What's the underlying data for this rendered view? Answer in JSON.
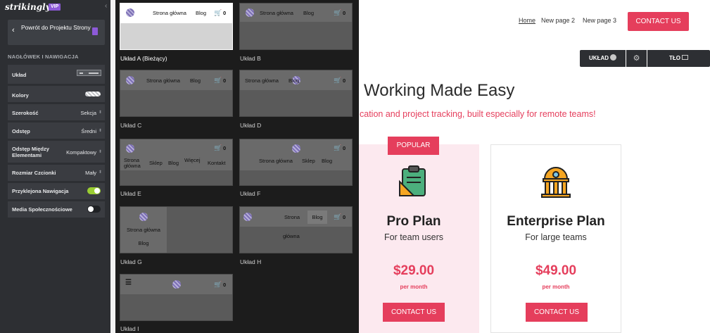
{
  "sidebar": {
    "logo": "strikingly",
    "vip": "VIP",
    "collapse": "‹",
    "back": "Powrót do Projektu Strony",
    "section_title": "NAGŁÓWEK I NAWIGACJA",
    "rows": [
      {
        "label": "Układ",
        "value": ""
      },
      {
        "label": "Kolory",
        "value": ""
      },
      {
        "label": "Szerokość",
        "value": "Sekcja"
      },
      {
        "label": "Odstęp",
        "value": "Średni"
      },
      {
        "label": "Odstęp Między Elementami",
        "value": "Kompaktowy"
      },
      {
        "label": "Rozmiar Czcionki",
        "value": "Mały"
      },
      {
        "label": "Przyklejona Nawigacja",
        "toggle": true
      },
      {
        "label": "Media Społecznościowe",
        "toggle": false
      }
    ]
  },
  "layouts": {
    "nav_home": "Strona główna",
    "nav_blog": "Blog",
    "nav_shop": "Sklep",
    "nav_more": "Więcej",
    "nav_contact": "Kontakt",
    "nav_strona": "Strona",
    "nav_glowna": "główna",
    "cart": "0",
    "captions": {
      "a": "Układ A (Bieżący)",
      "b": "Układ B",
      "c": "Układ C",
      "d": "Układ D",
      "e": "Układ E",
      "f": "Układ F",
      "g": "Układ G",
      "h": "Układ H",
      "i": "Układ I"
    }
  },
  "site": {
    "nav": [
      "Home",
      "New page 2",
      "New page 3"
    ],
    "contact": "CONTACT US",
    "editor_layout": "UKŁAD",
    "editor_bg": "TŁO",
    "hero_title": "e Working Made Easy",
    "hero_sub": "cation and project tracking, built especially for remote teams!",
    "popular": "POPULAR",
    "plans": [
      {
        "name": "Pro Plan",
        "for": "For team users",
        "price": "$29.00",
        "per": "per month",
        "cta": "CONTACT US"
      },
      {
        "name": "Enterprise Plan",
        "for": "For large teams",
        "price": "$49.00",
        "per": "per month",
        "cta": "CONTACT US"
      }
    ]
  },
  "colors": {
    "accent": "#e53e5c",
    "vip": "#8d5ad8",
    "toggle_on": "#9acd32"
  }
}
